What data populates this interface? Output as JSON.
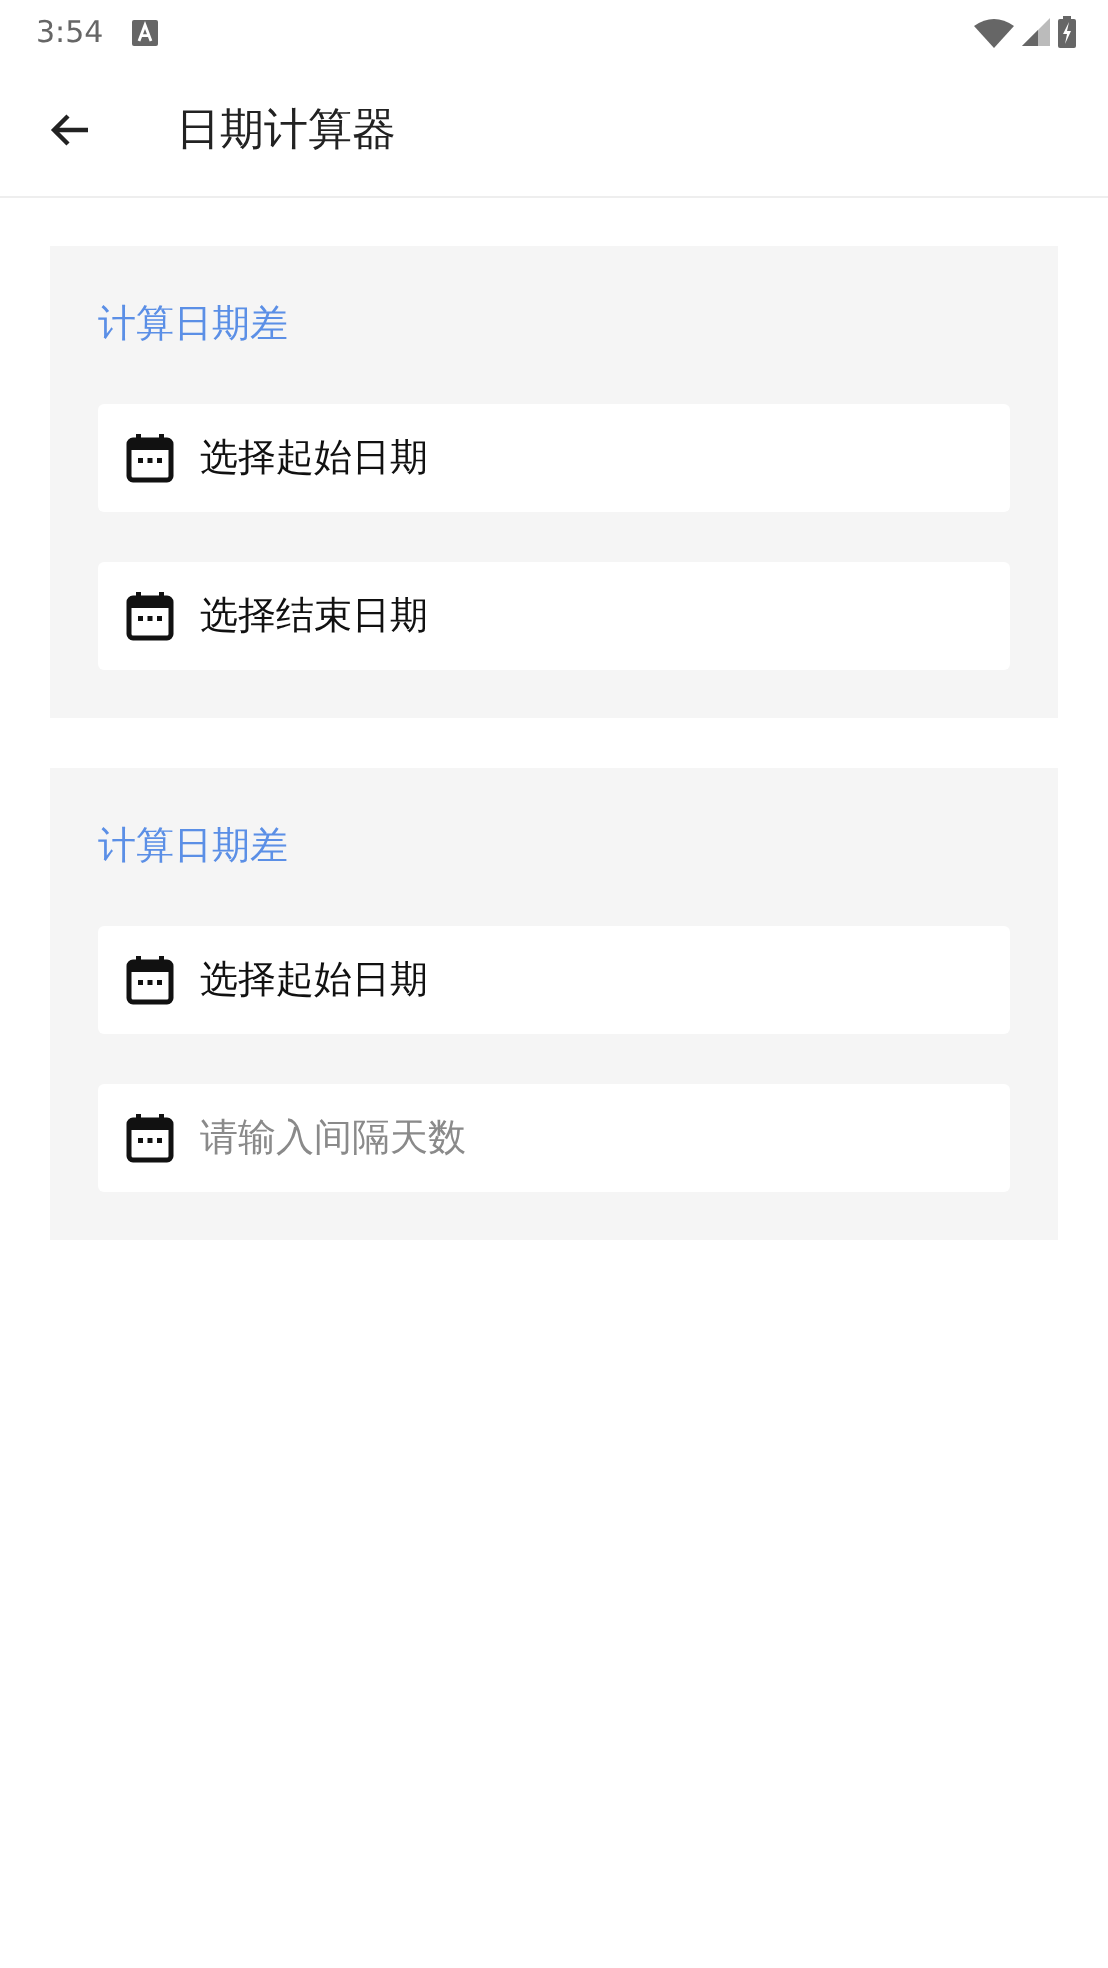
{
  "status_bar": {
    "time": "3:54"
  },
  "app_bar": {
    "title": "日期计算器"
  },
  "cards": [
    {
      "title": "计算日期差",
      "rows": [
        {
          "kind": "select",
          "label": "选择起始日期"
        },
        {
          "kind": "select",
          "label": "选择结束日期"
        }
      ]
    },
    {
      "title": "计算日期差",
      "rows": [
        {
          "kind": "select",
          "label": "选择起始日期"
        },
        {
          "kind": "input",
          "placeholder": "请输入间隔天数"
        }
      ]
    }
  ]
}
